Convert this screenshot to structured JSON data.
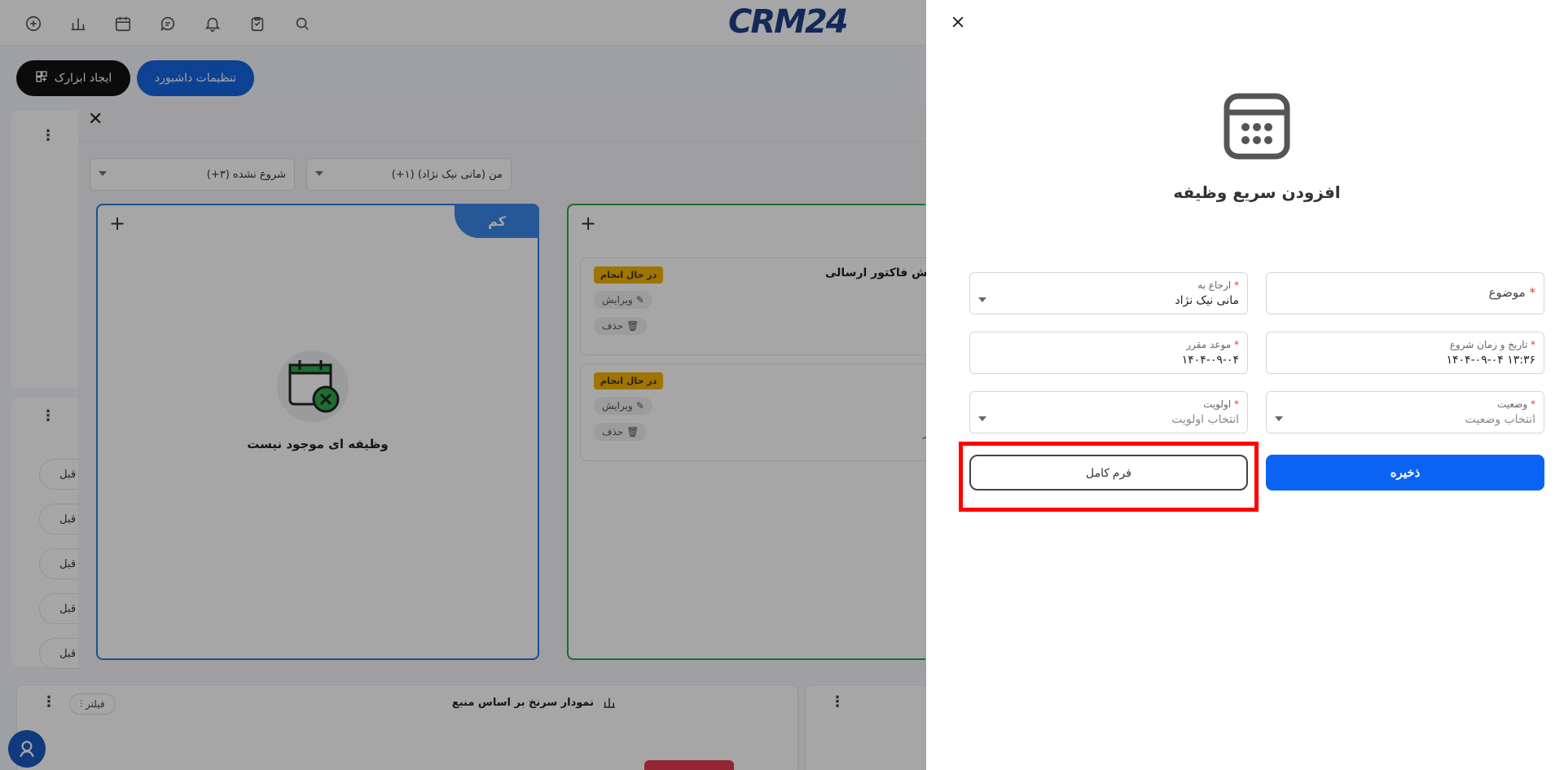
{
  "topbar": {
    "logo": "CRM24",
    "icons": [
      "add-circle-icon",
      "bar-chart-icon",
      "calendar-icon",
      "chat-icon",
      "bell-icon",
      "clipboard-icon",
      "search-icon"
    ]
  },
  "toolbar": {
    "create_tools_label": "ایجاد ابزارک",
    "dashboard_settings_label": "تنظیمات داشبورد"
  },
  "side_list": {
    "items": [
      "ماه قبل",
      "ماه قبل",
      "ماه قبل",
      "ماه قبل",
      "ماه قبل"
    ]
  },
  "bg_modal": {
    "filter_status": "شروع نشده (۳+)",
    "filter_assignee": "من (مانی نیک نژاد) (۱+)",
    "column_low": {
      "tag": "کم",
      "empty_text": "وظیفه ای موجود نیست"
    },
    "column_green": {
      "cards": [
        {
          "title": "پیش فاکتور ارسالی",
          "badge": "در حال انجام",
          "edit": "ویرایش",
          "delete": "حذف"
        },
        {
          "title": "",
          "badge": "در حال انجام",
          "edit": "ویرایش",
          "delete": "حذف",
          "link": "یز"
        }
      ]
    }
  },
  "bottom_panel": {
    "title": "نمودار سرنخ بر اساس منبع",
    "filter_label": "فیلتر"
  },
  "drawer": {
    "title": "افزودن سریع وظیفه",
    "fields": {
      "subject": {
        "label": "موضوع",
        "required": "*"
      },
      "assignee": {
        "label": "ارجاع به",
        "required": "*",
        "value": "مانی نیک نژاد"
      },
      "start": {
        "label": "تاریخ و زمان شروع",
        "required": "*",
        "value": "۱۴۰۴-۰۹-۰۴ ۱۳:۳۶"
      },
      "due": {
        "label": "موعد مقرر",
        "required": "*",
        "value": "۱۴۰۴-۰۹-۰۴"
      },
      "status": {
        "label": "وضعیت",
        "required": "*",
        "placeholder": "انتخاب وضعیت"
      },
      "priority": {
        "label": "اولویت",
        "required": "*",
        "placeholder": "انتخاب اولویت"
      }
    },
    "save_label": "ذخیره",
    "full_form_label": "فرم کامل"
  },
  "colors": {
    "primary": "#0b63f5",
    "highlight": "#ff0000",
    "low_column": "#3b86e8",
    "green_column": "#2bab4a",
    "badge": "#f5b301"
  }
}
